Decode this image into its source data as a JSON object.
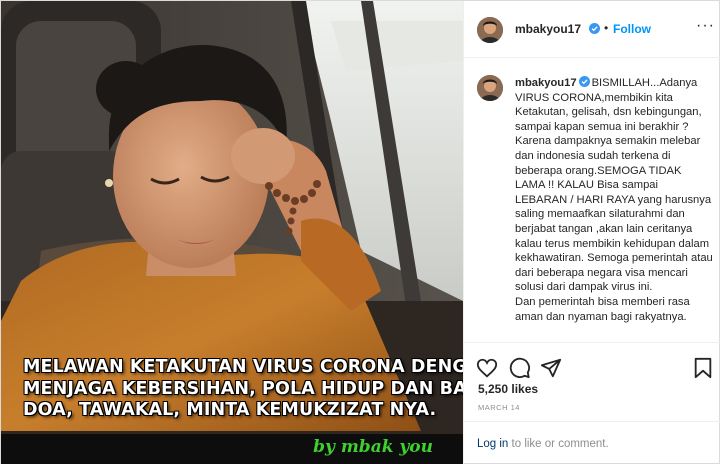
{
  "post": {
    "overlay_lines": [
      "MELAWAN KETAKUTAN VIRUS CORONA DENGAN",
      "MENJAGA KEBERSIHAN, POLA HIDUP DAN BANYAK",
      "DOA, TAWAKAL, MINTA KEMUKZIZAT NYA."
    ],
    "watermark": "by mbak you"
  },
  "header": {
    "username": "mbakyou17",
    "dot": "•",
    "follow_label": "Follow",
    "more_label": "···"
  },
  "caption": {
    "username": "mbakyou17",
    "text": "BISMILLAH...Adanya VIRUS CORONA,membikin kita Ketakutan, gelisah, dsn kebingungan, sampai kapan semua ini berakhir ? Karena dampaknya semakin melebar dan indonesia sudah terkena di beberapa orang.SEMOGA TIDAK LAMA !! KALAU Bisa sampai LEBARAN / HARI RAYA yang harusnya saling memaafkan silaturahmi dan berjabat tangan ,akan lain ceritanya kalau terus membikin kehidupan dalam kekhawatiran. Semoga pemerintah atau dari beberapa negara visa mencari solusi dari dampak virus ini.\nDan pemerintah bisa memberi rasa aman dan nyaman bagi rakyatnya."
  },
  "actions": {
    "like_icon": "heart-icon",
    "comment_icon": "comment-icon",
    "share_icon": "share-icon",
    "save_icon": "bookmark-icon"
  },
  "likes": "5,250 likes",
  "date": "MARCH 14",
  "login": {
    "link_label": "Log in",
    "suffix": " to like or comment."
  },
  "colors": {
    "accent_blue": "#0095f6",
    "verified_blue": "#3897f0",
    "watermark_green": "#3fcf2f",
    "muted_text": "#8e8e8e"
  }
}
